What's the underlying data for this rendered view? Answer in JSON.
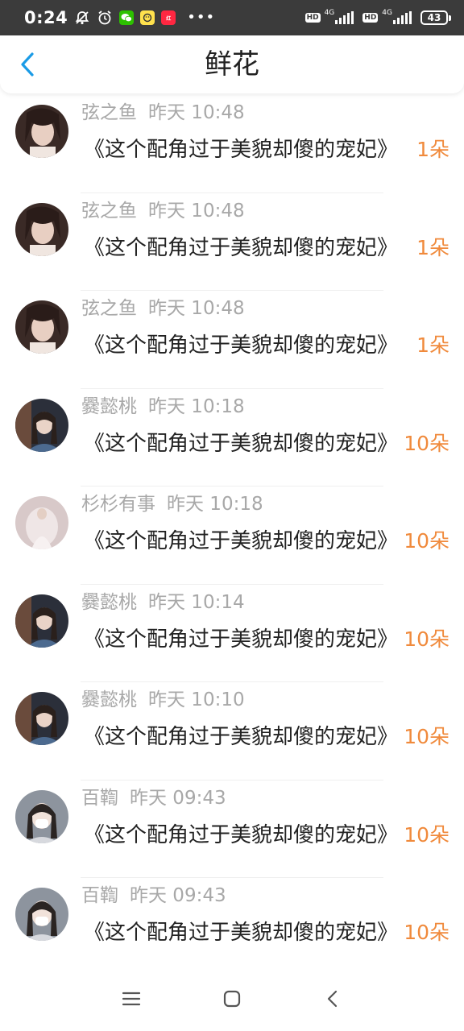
{
  "status_bar": {
    "time": "0:24",
    "network_1": "4G",
    "network_2": "4G",
    "hd_1": "HD",
    "hd_2": "HD",
    "battery": "43",
    "app_badge_1": "WeChat",
    "app_badge_2": "app",
    "app_badge_3": "小红书"
  },
  "header": {
    "title": "鲜花"
  },
  "list": [
    {
      "name": "弦之鱼",
      "time": "昨天 10:48",
      "message": "《这个配角过于美貌却傻的宠妃》",
      "count": "1朵",
      "avatar_color": "#6b4a3e"
    },
    {
      "name": "弦之鱼",
      "time": "昨天 10:48",
      "message": "《这个配角过于美貌却傻的宠妃》",
      "count": "1朵",
      "avatar_color": "#6b4a3e"
    },
    {
      "name": "弦之鱼",
      "time": "昨天 10:48",
      "message": "《这个配角过于美貌却傻的宠妃》",
      "count": "1朵",
      "avatar_color": "#6b4a3e"
    },
    {
      "name": "爨懿桃",
      "time": "昨天 10:18",
      "message": "《这个配角过于美貌却傻的宠妃》",
      "count": "10朵",
      "avatar_color": "#3f4a5c"
    },
    {
      "name": "杉杉有事",
      "time": "昨天 10:18",
      "message": "《这个配角过于美貌却傻的宠妃》",
      "count": "10朵",
      "avatar_color": "#d9c8c8"
    },
    {
      "name": "爨懿桃",
      "time": "昨天 10:14",
      "message": "《这个配角过于美貌却傻的宠妃》",
      "count": "10朵",
      "avatar_color": "#3f4a5c"
    },
    {
      "name": "爨懿桃",
      "time": "昨天 10:10",
      "message": "《这个配角过于美貌却傻的宠妃》",
      "count": "10朵",
      "avatar_color": "#3f4a5c"
    },
    {
      "name": "百鞫",
      "time": "昨天 09:43",
      "message": "《这个配角过于美貌却傻的宠妃》",
      "count": "10朵",
      "avatar_color": "#8a8f99"
    },
    {
      "name": "百鞫",
      "time": "昨天 09:43",
      "message": "《这个配角过于美貌却傻的宠妃》",
      "count": "10朵",
      "avatar_color": "#8a8f99"
    }
  ],
  "nav": {
    "menu_icon": "menu-icon",
    "home_icon": "home-icon",
    "back_icon": "back-icon"
  },
  "colors": {
    "accent": "#1a9be6",
    "count": "#f08a3c",
    "meta": "#a8a8a8",
    "status_bar": "#3b3b3b"
  }
}
